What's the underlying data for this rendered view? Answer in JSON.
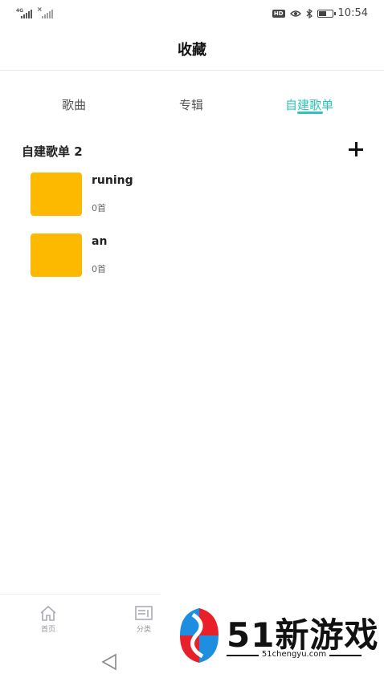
{
  "status_bar": {
    "sim1_network": "4G",
    "sim2_network": "×",
    "hd_badge": "HD",
    "time": "10:54",
    "battery_level": 0.6
  },
  "header": {
    "title": "收藏"
  },
  "tabs": [
    {
      "label": "歌曲",
      "active": false
    },
    {
      "label": "专辑",
      "active": false
    },
    {
      "label": "自建歌单",
      "active": true
    }
  ],
  "section": {
    "title": "自建歌单 2"
  },
  "playlists": [
    {
      "name": "runing",
      "count": "0首",
      "cover_color": "#fdb800"
    },
    {
      "name": "an",
      "count": "0首",
      "cover_color": "#fdb800"
    }
  ],
  "bottom_nav": [
    {
      "label": "首页",
      "icon": "home-icon"
    },
    {
      "label": "分类",
      "icon": "category-icon"
    }
  ],
  "watermark": {
    "text": "51新游戏",
    "sub": "51chengyu.com"
  },
  "colors": {
    "accent": "#2ec4b6",
    "cover": "#fdb800"
  }
}
